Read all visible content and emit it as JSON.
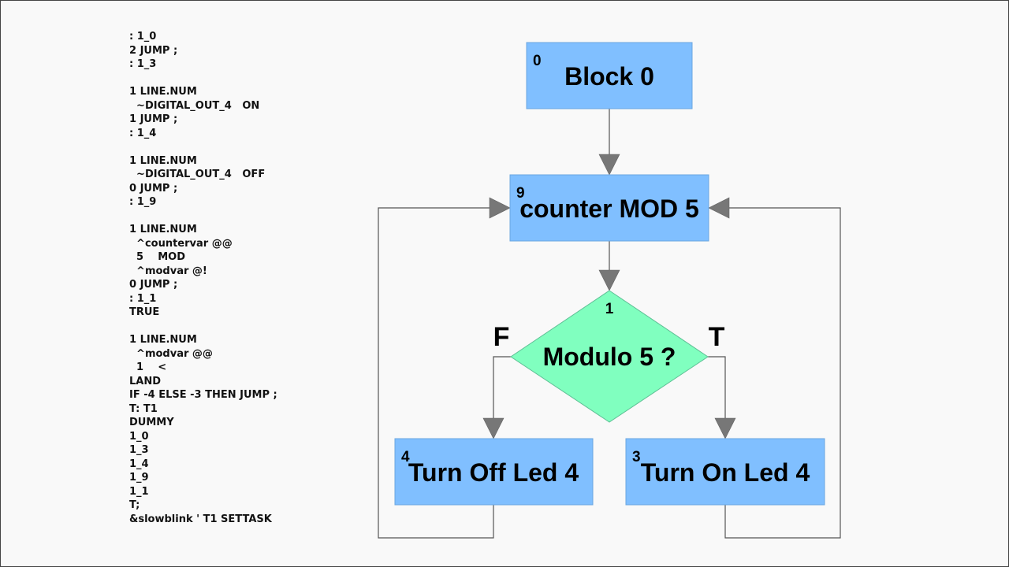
{
  "code_listing": {
    "lines": [
      ": 1_0",
      "2 JUMP ;",
      ": 1_3",
      "",
      "1 LINE.NUM",
      "  ~DIGITAL_OUT_4   ON",
      "1 JUMP ;",
      ": 1_4",
      "",
      "1 LINE.NUM",
      "  ~DIGITAL_OUT_4   OFF",
      "0 JUMP ;",
      ": 1_9",
      "",
      "1 LINE.NUM",
      "  ^countervar @@",
      "  5    MOD",
      "  ^modvar @!",
      "0 JUMP ;",
      ": 1_1",
      "TRUE",
      "",
      "1 LINE.NUM",
      "  ^modvar @@",
      "  1    <",
      "LAND",
      "IF -4 ELSE -3 THEN JUMP ;",
      "T: T1",
      "DUMMY",
      "1_0",
      "1_3",
      "1_4",
      "1_9",
      "1_1",
      "T;",
      "&slowblink ' T1 SETTASK"
    ]
  },
  "flowchart": {
    "colors": {
      "block_fill": "#80bfff",
      "decision_fill": "#80ffbf",
      "arrow": "#777777",
      "line": "#555555"
    },
    "nodes": {
      "block0": {
        "id": "0",
        "label": "Block 0",
        "shape": "rect"
      },
      "counter": {
        "id": "9",
        "label": "counter MOD 5",
        "shape": "rect"
      },
      "decision": {
        "id": "1",
        "label": "Modulo 5 ?",
        "shape": "diamond"
      },
      "turn_off": {
        "id": "4",
        "label": "Turn Off Led 4",
        "shape": "rect"
      },
      "turn_on": {
        "id": "3",
        "label": "Turn On Led 4",
        "shape": "rect"
      }
    },
    "branch_labels": {
      "false": "F",
      "true": "T"
    },
    "edges": [
      {
        "from": "block0",
        "to": "counter"
      },
      {
        "from": "counter",
        "to": "decision"
      },
      {
        "from": "decision",
        "to": "turn_off",
        "label": "F"
      },
      {
        "from": "decision",
        "to": "turn_on",
        "label": "T"
      },
      {
        "from": "turn_off",
        "to": "counter"
      },
      {
        "from": "turn_on",
        "to": "counter"
      }
    ]
  }
}
